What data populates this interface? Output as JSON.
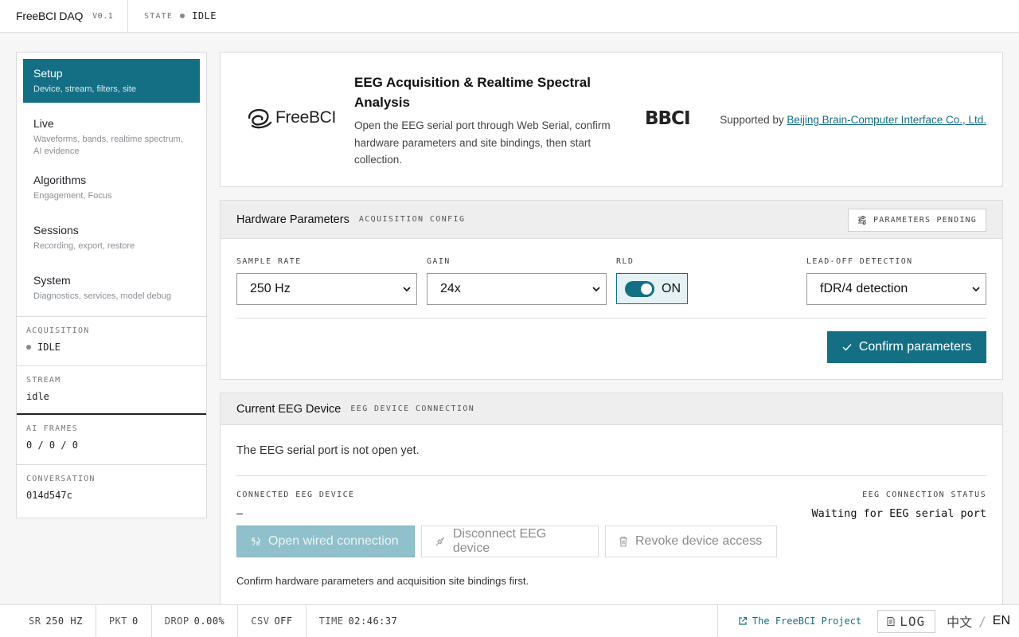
{
  "app": {
    "name": "FreeBCI DAQ",
    "version": "V0.1"
  },
  "topbar": {
    "state_label": "STATE",
    "state_value": "IDLE"
  },
  "sidebar": {
    "items": [
      {
        "label": "Setup",
        "sub": "Device, stream, filters, site",
        "active": true
      },
      {
        "label": "Live",
        "sub": "Waveforms, bands, realtime spectrum, AI evidence"
      },
      {
        "label": "Algorithms",
        "sub": "Engagement, Focus"
      },
      {
        "label": "Sessions",
        "sub": "Recording, export, restore"
      },
      {
        "label": "System",
        "sub": "Diagnostics, services, model debug"
      }
    ],
    "stats": {
      "acquisition": {
        "label": "ACQUISITION",
        "value": "IDLE"
      },
      "stream": {
        "label": "STREAM",
        "value": "idle"
      },
      "ai_frames": {
        "label": "AI FRAMES",
        "value": "0 / 0 / 0"
      },
      "conversation": {
        "label": "CONVERSATION",
        "value": "014d547c"
      }
    }
  },
  "hero": {
    "logo_text": "FreeBCI",
    "title": "EEG Acquisition & Realtime Spectral Analysis",
    "description": "Open the EEG serial port through Web Serial, confirm hardware parameters and site bindings, then start collection.",
    "partner_logo": "BBCI",
    "supported_prefix": "Supported by",
    "supported_link": "Beijing Brain-Computer Interface Co., Ltd."
  },
  "hardware": {
    "title": "Hardware Parameters",
    "tag": "ACQUISITION CONFIG",
    "pending_label": "PARAMETERS PENDING",
    "sample_rate": {
      "label": "SAMPLE RATE",
      "value": "250 Hz"
    },
    "gain": {
      "label": "GAIN",
      "value": "24x"
    },
    "rld": {
      "label": "RLD",
      "value": "ON"
    },
    "lead_off": {
      "label": "LEAD-OFF DETECTION",
      "value": "fDR/4 detection"
    },
    "confirm_label": "Confirm parameters"
  },
  "device": {
    "title": "Current EEG Device",
    "tag": "EEG DEVICE CONNECTION",
    "message": "The EEG serial port is not open yet.",
    "connected_label": "CONNECTED EEG DEVICE",
    "connected_value": "—",
    "status_label": "EEG CONNECTION STATUS",
    "status_value": "Waiting for EEG serial port",
    "open_label": "Open wired connection",
    "disconnect_label": "Disconnect EEG device",
    "revoke_label": "Revoke device access",
    "hint": "Confirm hardware parameters and acquisition site bindings first."
  },
  "footer": {
    "sr": {
      "label": "SR",
      "value": "250 HZ"
    },
    "pkt": {
      "label": "PKT",
      "value": "0"
    },
    "drop": {
      "label": "DROP",
      "value": "0.00%"
    },
    "csv": {
      "label": "CSV",
      "value": "OFF"
    },
    "time": {
      "label": "TIME",
      "value": "02:46:37"
    },
    "project_link": "The FreeBCI Project",
    "log_label": "LOG",
    "lang_zh": "中文",
    "lang_sep": "/",
    "lang_en": "EN"
  },
  "colors": {
    "accent": "#146f85",
    "accent_light": "#e4f2f5",
    "idle_dot": "#888888"
  }
}
